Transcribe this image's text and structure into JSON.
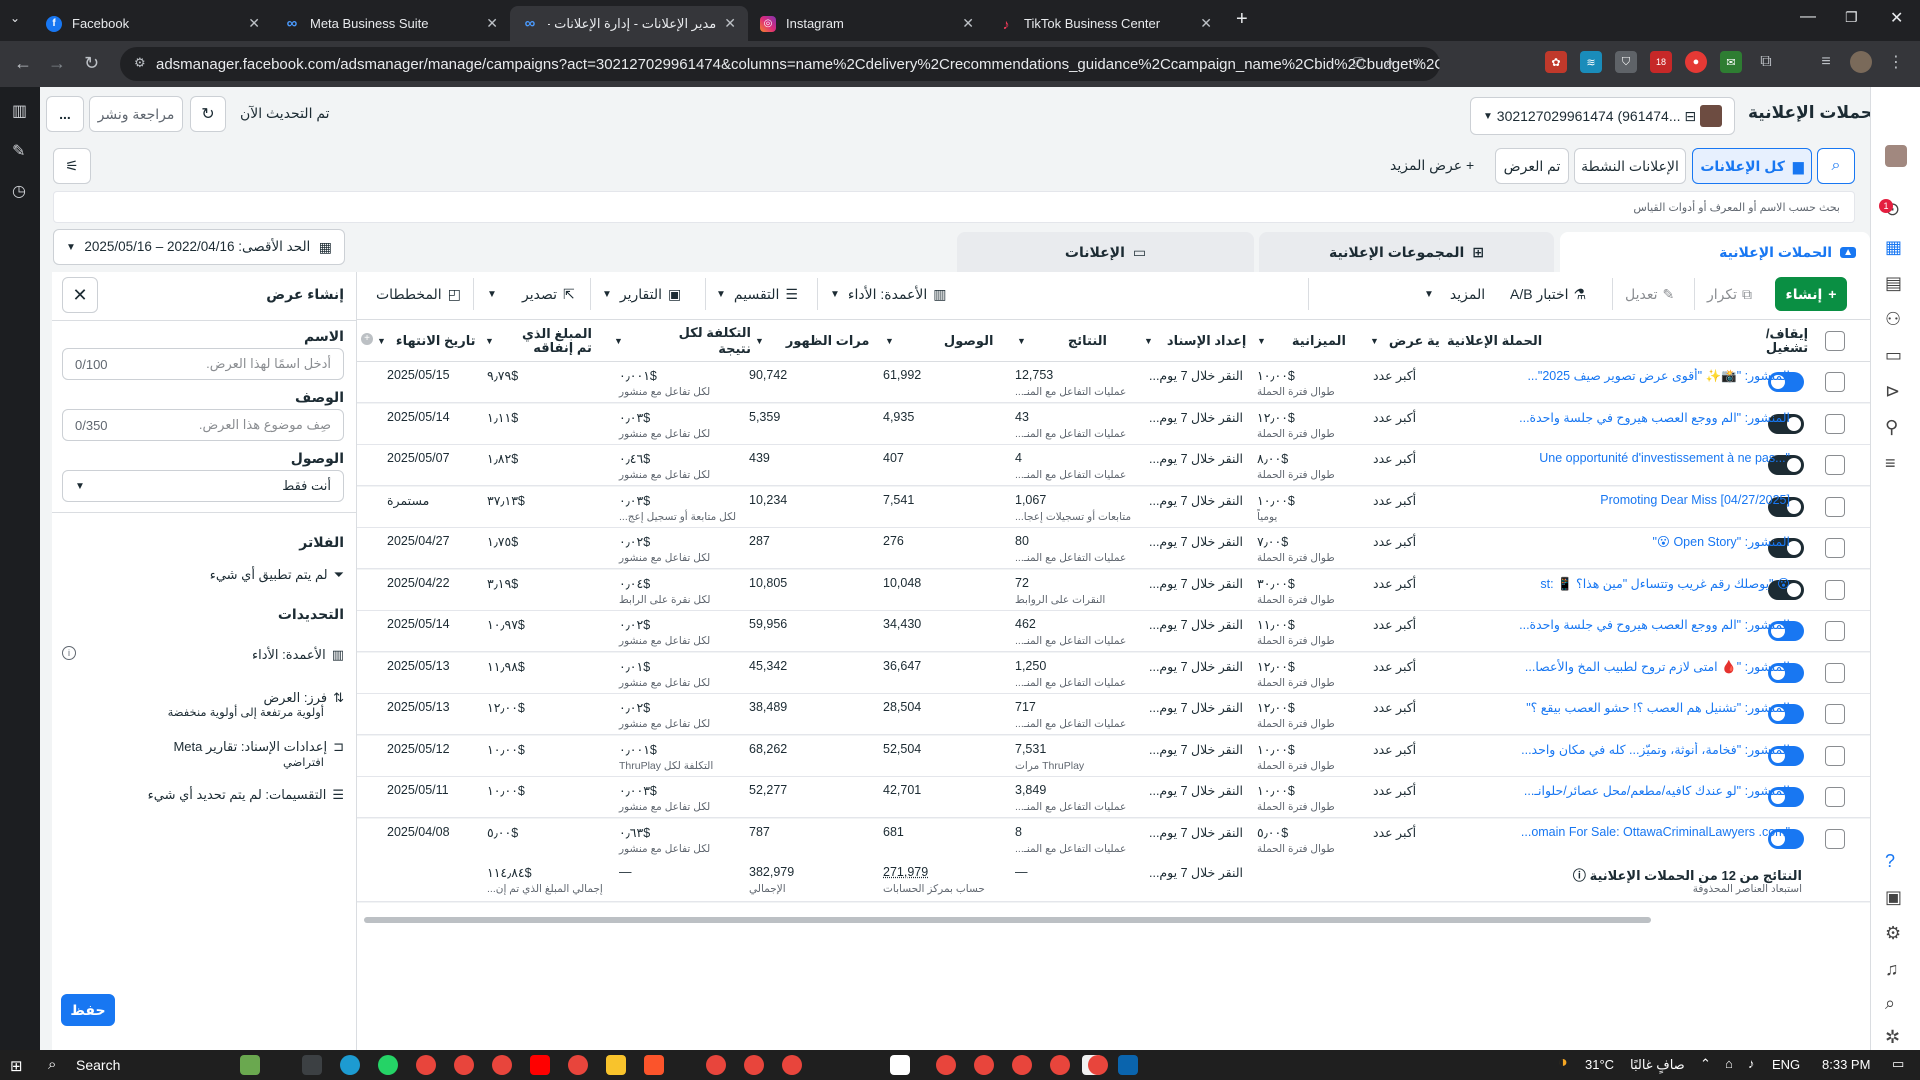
{
  "browser": {
    "tabs": [
      {
        "title": "Facebook",
        "color": "#1877f2",
        "glyph": "f"
      },
      {
        "title": "Meta Business Suite",
        "color": "#0866ff",
        "glyph": "∞"
      },
      {
        "title": "مدير الإعلانات - إدارة الإعلانات - ...",
        "color": "#0866ff",
        "glyph": "∞"
      },
      {
        "title": "Instagram",
        "color": "#e1306c",
        "glyph": "◎"
      },
      {
        "title": "TikTok Business Center",
        "color": "#000000",
        "glyph": "♪"
      }
    ],
    "url": "adsmanager.facebook.com/adsmanager/manage/campaigns?act=302127029961474&columns=name%2Cdelivery%2Crecommendations_guidance%2Ccampaign_name%2Cbid%2Cbudget%2Clast_signific..."
  },
  "header": {
    "title": "الحملات الإعلانية",
    "account": "302127029961474 (961474...",
    "updated": "تم التحديث الآن",
    "review_publish": "مراجعة ونشر",
    "more": "..."
  },
  "filters": {
    "all_ads": "كل الإعلانات",
    "active_ads": "الإعلانات النشطة",
    "shown": "تم العرض",
    "view_more": "عرض المزيد",
    "search_placeholder": "بحث حسب الاسم أو المعرف أو أدوات القياس",
    "date_range": "الحد الأقصى: 2022/04/16 – 2025/05/16"
  },
  "level_tabs": {
    "campaigns": "الحملات الإعلانية",
    "adsets": "المجموعات الإعلانية",
    "ads": "الإعلانات"
  },
  "toolbar": {
    "create": "إنشاء",
    "duplicate": "تكرار",
    "edit": "تعديل",
    "ab_test": "اختبار A/B",
    "more": "المزيد",
    "columns": "الأعمدة: الأداء",
    "breakdown": "التقسيم",
    "reports": "التقارير",
    "export": "تصدير",
    "charts": "المخططات"
  },
  "columns": {
    "onoff": "إيقاف/ تشغيل",
    "campaign": "الحملة الإعلانية",
    "bid": "ية عرض",
    "budget": "الميزانية",
    "attribution": "إعداد الإسناد",
    "results": "النتائج",
    "reach": "الوصول",
    "impressions": "مرات الظهور",
    "cost": "التكلفة لكل نتيجة",
    "spent": "المبلغ الذي تم إنفاقه",
    "end": "تاريخ الانتهاء"
  },
  "rows": [
    {
      "on": true,
      "name": "المنشور: \"📸✨ \"أقوى عرض تصوير صيف 2025\"...",
      "bid": "أكبر عدد",
      "budget": "١٠٫٠٠$",
      "budget_sub": "طوال فترة الحملة",
      "attr": "النقر خلال 7 يوم...",
      "results": "12,753",
      "results_sub": "عمليات التفاعل مع المنـ...",
      "reach": "61,992",
      "impr": "90,742",
      "cost": "٠٫٠٠١$",
      "cost_sub": "لكل تفاعل مع منشور",
      "spent": "٩٫٧٩$",
      "end": "2025/05/15"
    },
    {
      "on": false,
      "name": "المنشور: \"الم ووجع العصب هيروح في جلسة واحدة...",
      "bid": "أكبر عدد",
      "budget": "١٢٫٠٠$",
      "budget_sub": "طوال فترة الحملة",
      "attr": "النقر خلال 7 يوم...",
      "results": "43",
      "results_sub": "عمليات التفاعل مع المنـ...",
      "reach": "4,935",
      "impr": "5,359",
      "cost": "٠٫٠٣$",
      "cost_sub": "لكل تفاعل مع منشور",
      "spent": "١٫١١$",
      "end": "2025/05/14"
    },
    {
      "on": false,
      "name": "\"...Une opportunité d'investissement à ne pas",
      "bid": "أكبر عدد",
      "budget": "٨٫٠٠$",
      "budget_sub": "طوال فترة الحملة",
      "attr": "النقر خلال 7 يوم...",
      "results": "4",
      "results_sub": "عمليات التفاعل مع المنـ...",
      "reach": "407",
      "impr": "439",
      "cost": "٠٫٤٦$",
      "cost_sub": "لكل تفاعل مع منشور",
      "spent": "١٫٨٢$",
      "end": "2025/05/07"
    },
    {
      "on": false,
      "name": "[04/27/2025] Promoting Dear Miss",
      "bid": "أكبر عدد",
      "budget": "١٠٫٠٠$",
      "budget_sub": "يومياً",
      "attr": "النقر خلال 7 يوم...",
      "results": "1,067",
      "results_sub": "متابعات أو تسجيلات إعجا...",
      "reach": "7,541",
      "impr": "10,234",
      "cost": "٠٫٠٣$",
      "cost_sub": "لكل متابعة أو تسجيل إعج...",
      "spent": "٣٧٫١٣$",
      "end": "مستمرة"
    },
    {
      "on": false,
      "name": "المنشور: \"Open Story 😮\"",
      "bid": "أكبر عدد",
      "budget": "٧٫٠٠$",
      "budget_sub": "طوال فترة الحملة",
      "attr": "النقر خلال 7 يوم...",
      "results": "80",
      "results_sub": "عمليات التفاعل مع المنـ...",
      "reach": "276",
      "impr": "287",
      "cost": "٠٫٠٢$",
      "cost_sub": "لكل تفاعل مع منشور",
      "spent": "١٫٧٥$",
      "end": "2025/04/27"
    },
    {
      "on": false,
      "name": "😮 \"يوصلك رقم غريب وتتساءل \"مين هذا؟ 📱 :st",
      "bid": "أكبر عدد",
      "budget": "٣٠٫٠٠$",
      "budget_sub": "طوال فترة الحملة",
      "attr": "النقر خلال 7 يوم...",
      "results": "72",
      "results_sub": "النقرات على الروابط",
      "reach": "10,048",
      "impr": "10,805",
      "cost": "٠٫٠٤$",
      "cost_sub": "لكل نقرة على الرابط",
      "spent": "٣٫١٩$",
      "end": "2025/04/22"
    },
    {
      "on": true,
      "name": "المنشور: \"الم ووجع العصب هيروح في جلسة واحدة...",
      "bid": "أكبر عدد",
      "budget": "١١٫٠٠$",
      "budget_sub": "طوال فترة الحملة",
      "attr": "النقر خلال 7 يوم...",
      "results": "462",
      "results_sub": "عمليات التفاعل مع المنـ...",
      "reach": "34,430",
      "impr": "59,956",
      "cost": "٠٫٠٢$",
      "cost_sub": "لكل تفاعل مع منشور",
      "spent": "١٠٫٩٧$",
      "end": "2025/05/14"
    },
    {
      "on": true,
      "name": "المنشور: \"🩸 امتى لازم تروح لطبيب المخ والأعصا...",
      "bid": "أكبر عدد",
      "budget": "١٢٫٠٠$",
      "budget_sub": "طوال فترة الحملة",
      "attr": "النقر خلال 7 يوم...",
      "results": "1,250",
      "results_sub": "عمليات التفاعل مع المنـ...",
      "reach": "36,647",
      "impr": "45,342",
      "cost": "٠٫٠١$",
      "cost_sub": "لكل تفاعل مع منشور",
      "spent": "١١٫٩٨$",
      "end": "2025/05/13"
    },
    {
      "on": true,
      "name": "المنشور: \"تشنيل هم العصب ؟! حشو العصب بيقع ؟\"",
      "bid": "أكبر عدد",
      "budget": "١٢٫٠٠$",
      "budget_sub": "طوال فترة الحملة",
      "attr": "النقر خلال 7 يوم...",
      "results": "717",
      "results_sub": "عمليات التفاعل مع المنـ...",
      "reach": "28,504",
      "impr": "38,489",
      "cost": "٠٫٠٢$",
      "cost_sub": "لكل تفاعل مع منشور",
      "spent": "١٢٫٠٠$",
      "end": "2025/05/13"
    },
    {
      "on": true,
      "name": "المنشور: \"فخامة، أنوثة، وتميّز... كله في مكان واحد...",
      "bid": "أكبر عدد",
      "budget": "١٠٫٠٠$",
      "budget_sub": "طوال فترة الحملة",
      "attr": "النقر خلال 7 يوم...",
      "results": "7,531",
      "results_sub": "ThruPlay مرات",
      "reach": "52,504",
      "impr": "68,262",
      "cost": "٠٫٠٠١$",
      "cost_sub": "التكلفة لكل ThruPlay",
      "spent": "١٠٫٠٠$",
      "end": "2025/05/12"
    },
    {
      "on": true,
      "name": "المنشور: \"لو عندك كافيه/مطعم/محل عصائر/حلوانـ...",
      "bid": "أكبر عدد",
      "budget": "١٠٫٠٠$",
      "budget_sub": "طوال فترة الحملة",
      "attr": "النقر خلال 7 يوم...",
      "results": "3,849",
      "results_sub": "عمليات التفاعل مع المنـ...",
      "reach": "42,701",
      "impr": "52,277",
      "cost": "٠٫٠٠٣$",
      "cost_sub": "لكل تفاعل مع منشور",
      "spent": "١٠٫٠٠$",
      "end": "2025/05/11"
    },
    {
      "on": true,
      "name": "\"omain For Sale: OttawaCriminalLawyers .com...",
      "bid": "أكبر عدد",
      "budget": "٥٫٠٠$",
      "budget_sub": "طوال فترة الحملة",
      "attr": "النقر خلال 7 يوم...",
      "results": "8",
      "results_sub": "عمليات التفاعل مع المنـ...",
      "reach": "681",
      "impr": "787",
      "cost": "٠٫٦٣$",
      "cost_sub": "لكل تفاعل مع منشور",
      "spent": "٥٫٠٠$",
      "end": "2025/04/08"
    }
  ],
  "totals": {
    "label": "النتائج من 12 من الحملات الإعلانية",
    "sub": "استبعاد العناصر المحذوفة",
    "attr": "النقر خلال 7 يوم...",
    "results": "—",
    "reach": "271,979",
    "reach_sub": "حساب بمركز الحسابات",
    "impr": "382,979",
    "impr_sub": "الإجمالي",
    "cost": "—",
    "spent": "١١٤٫٨٤$",
    "spent_sub": "إجمالي المبلغ الذي تم إن..."
  },
  "panel": {
    "title": "إنشاء عرض",
    "name_label": "الاسم",
    "name_placeholder": "أدخل اسمًا لهذا العرض.",
    "name_count": "0/100",
    "desc_label": "الوصف",
    "desc_placeholder": "صِف موضوع هذا العرض.",
    "desc_count": "0/350",
    "access_label": "الوصول",
    "access_value": "أنت فقط",
    "filters_label": "الفلاتر",
    "filters_value": "لم يتم تطبيق أي شيء",
    "settings_label": "التحديدات",
    "columns_value": "الأعمدة: الأداء",
    "sort_value": "فرز: العرض",
    "sort_sub": "أولوية مرتفعة إلى أولوية منخفضة",
    "attr_value": "إعدادات الإسناد: تقارير Meta",
    "attr_sub": "افتراضي",
    "breakdown_value": "التقسيمات: لم يتم تحديد أي شيء",
    "save": "حفظ"
  },
  "taskbar": {
    "search": "Search",
    "weather": "31°C",
    "weather_desc": "صافٍ غالبًا",
    "lang": "ENG",
    "time": "8:33 PM"
  },
  "notif_count": "1",
  "ext_badge": "18"
}
